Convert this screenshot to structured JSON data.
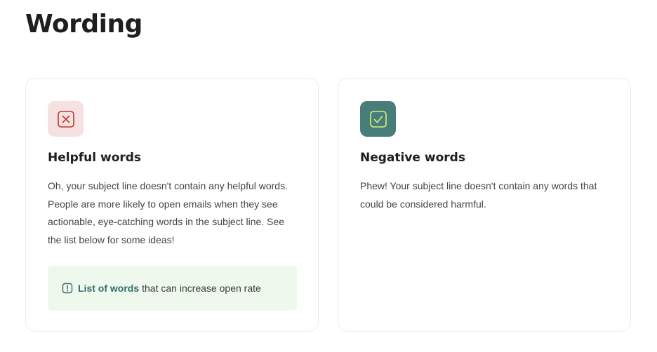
{
  "page": {
    "title": "Wording"
  },
  "cards": {
    "helpful": {
      "icon": "x-box-icon",
      "title": "Helpful words",
      "body": "Oh, your subject line doesn't contain any helpful words. People are more likely to open emails when they see actionable, eye-catching words in the subject line. See the list below for some ideas!",
      "tip": {
        "icon": "alert-icon",
        "link_label": "List of words",
        "text": "that can increase open rate"
      }
    },
    "negative": {
      "icon": "check-box-icon",
      "title": "Negative words",
      "body": "Phew! Your subject line doesn't contain any words that could be considered harmful."
    }
  },
  "colors": {
    "bad_tile_bg": "#f5e1e1",
    "bad_icon": "#c0392b",
    "good_tile_bg": "#497d7a",
    "good_icon": "#d9f27a",
    "tip_bg": "#eef8ec",
    "link": "#2f6f6a"
  }
}
